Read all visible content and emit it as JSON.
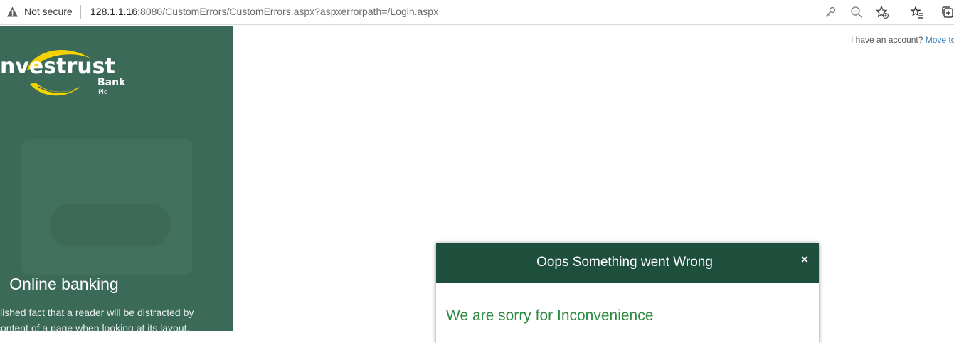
{
  "browser": {
    "security_label": "Not secure",
    "url_host": "128.1.1.16",
    "url_rest": ":8080/CustomErrors/CustomErrors.aspx?aspxerrorpath=/Login.aspx",
    "toolbar_icons": [
      "key-icon",
      "zoom-out-icon",
      "add-favorite-icon",
      "favorites-icon",
      "collections-icon"
    ]
  },
  "sidebar": {
    "brand": {
      "name": "nvestrust",
      "bank": "Bank",
      "suffix": "Plc"
    },
    "title": "Online banking",
    "description_lines": [
      "lished fact that a reader will be distracted by",
      "content of a page when looking at its layout."
    ],
    "colors": {
      "panel": "#3b6b58",
      "logo": "#f3d200"
    }
  },
  "account": {
    "prompt": "I have an account?",
    "link": "Move to login"
  },
  "modal": {
    "title": "Oops Something went Wrong",
    "close_label": "×",
    "message": "We are sorry for Inconvenience",
    "colors": {
      "header": "#1e4f3d",
      "message": "#2e8b43"
    }
  }
}
